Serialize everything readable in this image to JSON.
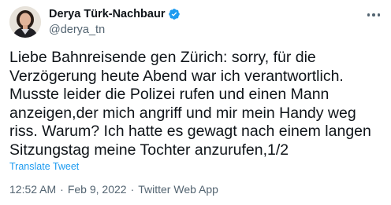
{
  "author": {
    "display_name": "Derya Türk-Nachbaur",
    "handle": "@derya_tn",
    "verified": true
  },
  "tweet": {
    "lines": [
      "Liebe Bahnreisende gen Zürich: sorry, für die",
      "Verzögerung heute Abend war ich verantwortlich.",
      "Musste leider die Polizei rufen und einen Mann",
      "anzeigen,der mich angriff und mir mein Handy weg",
      "riss. Warum? Ich hatte es gewagt nach einem langen",
      "Sitzungstag meine Tochter anzurufen,1/2"
    ],
    "translate_label": "Translate Tweet"
  },
  "meta": {
    "time": "12:52 AM",
    "separator": "·",
    "date": "Feb 9, 2022",
    "source": "Twitter Web App"
  },
  "icons": {
    "verified": "verified-badge-icon",
    "more": "more-options-icon"
  },
  "colors": {
    "text": "#0f1419",
    "secondary": "#536471",
    "link": "#1d9bf0",
    "verified": "#1d9bf0"
  }
}
